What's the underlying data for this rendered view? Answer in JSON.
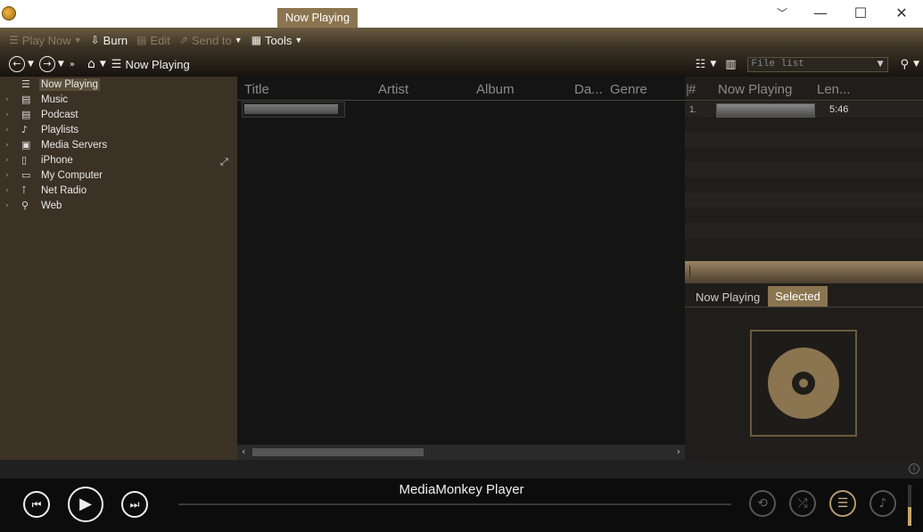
{
  "window": {
    "active_tab": "Now Playing",
    "controls": {
      "dropdown": "﹀",
      "minimize": "—",
      "maximize": "☐",
      "close": "✕"
    }
  },
  "toolbar": {
    "menu": [
      {
        "label": "Play Now",
        "icon": "queue-icon",
        "enabled": false
      },
      {
        "label": "Burn",
        "icon": "burn-icon",
        "enabled": true
      },
      {
        "label": "Edit",
        "icon": "edit-icon",
        "enabled": false
      },
      {
        "label": "Send to",
        "icon": "send-to-icon",
        "enabled": false
      },
      {
        "label": "Tools",
        "icon": "tools-icon",
        "enabled": true
      }
    ],
    "breadcrumb": "Now Playing",
    "file_list_placeholder": "File list"
  },
  "sidebar": {
    "items": [
      {
        "label": "Now Playing",
        "icon": "now-playing-icon",
        "selected": true
      },
      {
        "label": "Music",
        "icon": "music-icon"
      },
      {
        "label": "Podcast",
        "icon": "podcast-icon"
      },
      {
        "label": "Playlists",
        "icon": "playlist-icon"
      },
      {
        "label": "Media Servers",
        "icon": "media-server-icon"
      },
      {
        "label": "iPhone",
        "icon": "iphone-icon"
      },
      {
        "label": "My Computer",
        "icon": "computer-icon"
      },
      {
        "label": "Net Radio",
        "icon": "radio-icon"
      },
      {
        "label": "Web",
        "icon": "web-icon"
      }
    ]
  },
  "tracklist": {
    "columns": [
      "Title",
      "Artist",
      "Album",
      "Da...",
      "Genre"
    ]
  },
  "now_playing_panel": {
    "columns": [
      "#",
      "Now Playing",
      "Len..."
    ],
    "rows": [
      {
        "num": "1.",
        "length": "5:46"
      }
    ],
    "tabs": [
      "Now Playing",
      "Selected"
    ],
    "selected_tab": "Selected"
  },
  "player": {
    "title": "MediaMonkey Player",
    "volume_level": 0.45
  },
  "colors": {
    "accent": "#8b7550",
    "sidebar_bg": "#3b3225",
    "main_bg": "#141414"
  }
}
